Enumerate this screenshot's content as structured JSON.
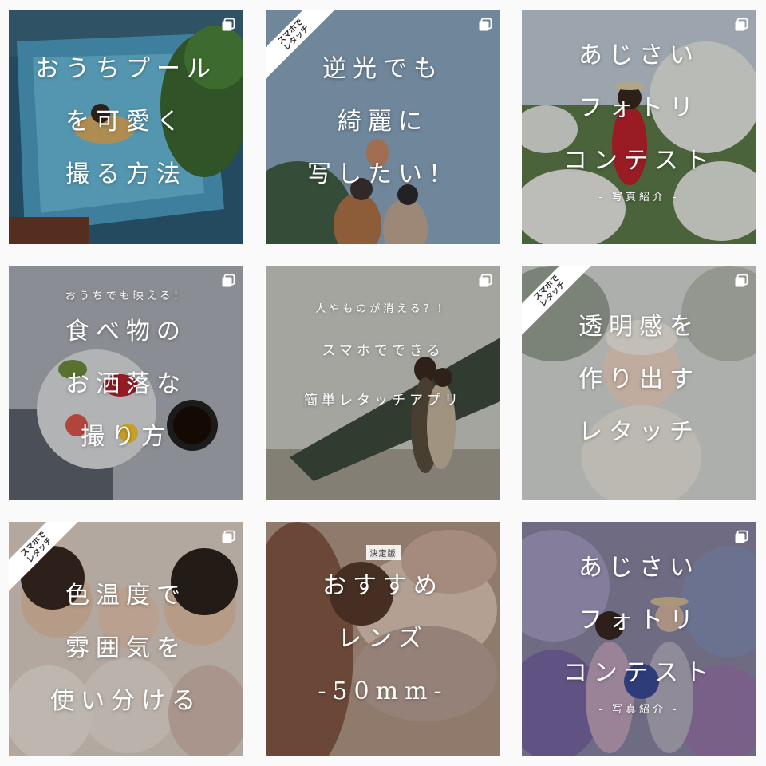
{
  "posts": [
    {
      "lines": [
        "おうちプール",
        "を可愛く",
        "撮る方法"
      ],
      "sub": ""
    },
    {
      "ribbon": [
        "スマホで",
        "レタッチ"
      ],
      "lines": [
        "逆光でも",
        "綺麗に",
        "写したい！"
      ],
      "sub": ""
    },
    {
      "lines": [
        "あじさい",
        "フォトリ",
        "コンテスト"
      ],
      "sub": "- 写真紹介 -"
    },
    {
      "kicker": "おうちでも映える！",
      "lines": [
        "食べ物の",
        "お洒落な",
        "撮り方"
      ],
      "sub": ""
    },
    {
      "kicker": "人やものが消える？！",
      "lines": [
        "スマホでできる",
        "簡単レタッチアプリ"
      ],
      "sub": ""
    },
    {
      "ribbon": [
        "スマホで",
        "レタッチ"
      ],
      "lines": [
        "透明感を",
        "作り出す",
        "レタッチ"
      ],
      "sub": ""
    },
    {
      "ribbon": [
        "スマホで",
        "レタッチ"
      ],
      "lines": [
        "色温度で",
        "雰囲気を",
        "使い分ける"
      ],
      "sub": ""
    },
    {
      "badge": "決定版",
      "lines": [
        "おすすめ",
        "レンズ",
        "-50mm-"
      ],
      "sub": ""
    },
    {
      "lines": [
        "あじさい",
        "フォトリ",
        "コンテスト"
      ],
      "sub": "- 写真紹介 -"
    }
  ],
  "icons": {
    "multi": "carousel-icon"
  }
}
